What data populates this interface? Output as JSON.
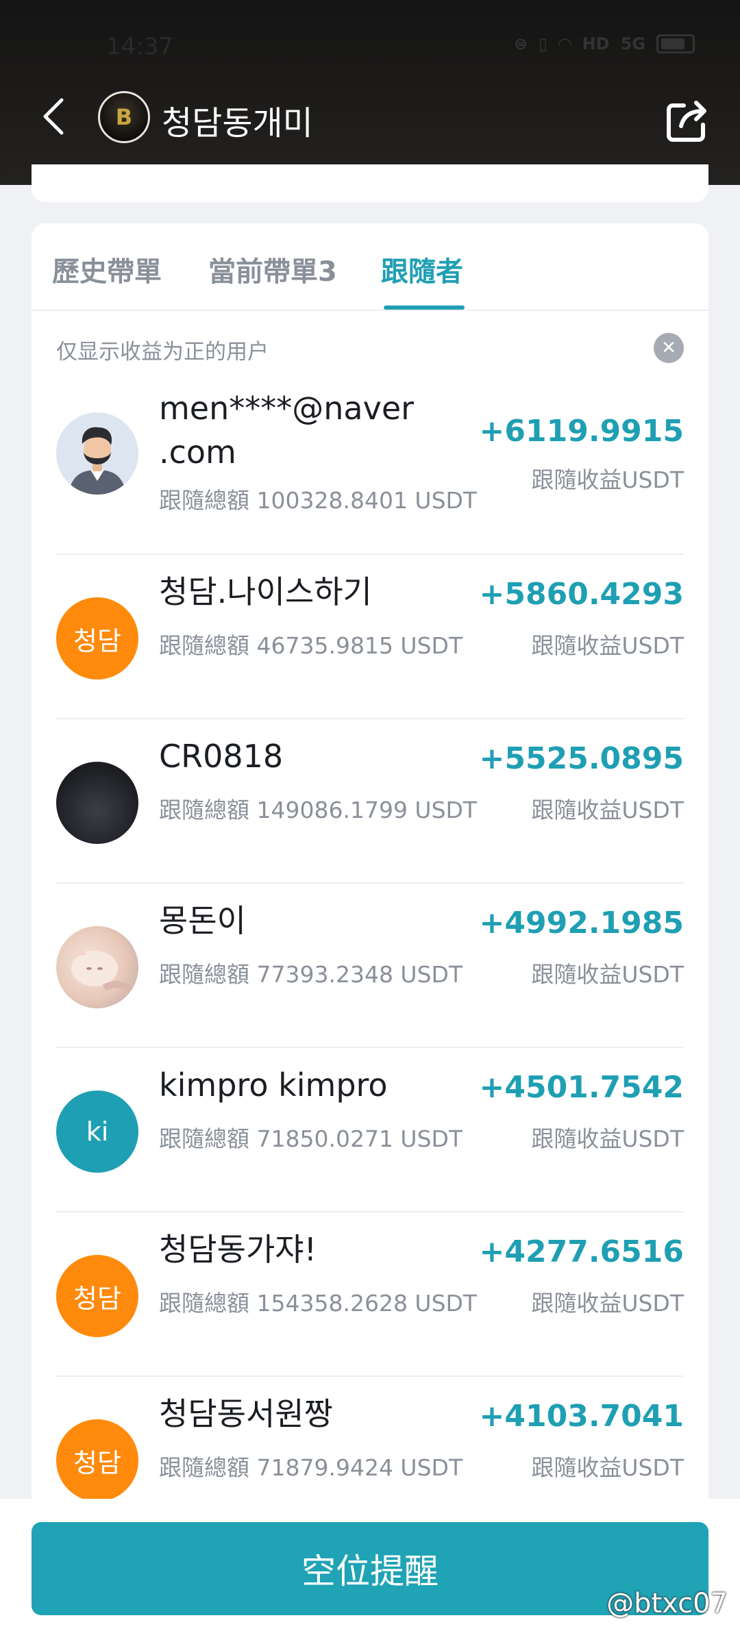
{
  "status": {
    "time": "14:37",
    "icons": [
      "vpn-icon",
      "vibrate-icon",
      "wifi-icon",
      "hd-icon",
      "signal-5g-icon",
      "battery-icon"
    ]
  },
  "header": {
    "title": "청담동개미",
    "avatar_text": "B"
  },
  "tabs": [
    {
      "label": "歷史帶單"
    },
    {
      "label": "當前帶單3"
    },
    {
      "label": "跟隨者"
    }
  ],
  "filter": {
    "text": "仅显示收益为正的用户"
  },
  "followers": [
    {
      "name_line1": "men****@naver",
      "name_line2": ".com",
      "total": "跟隨總額 100328.8401 USDT",
      "profit": "+6119.9915",
      "profit_label": "跟隨收益USDT",
      "avatar": "man-icon"
    },
    {
      "name_line1": "청담.나이스하기",
      "total": "跟隨總額 46735.9815 USDT",
      "profit": "+5860.4293",
      "profit_label": "跟隨收益USDT",
      "avatar_text": "청담"
    },
    {
      "name_line1": "CR0818",
      "total": "跟隨總額 149086.1799 USDT",
      "profit": "+5525.0895",
      "profit_label": "跟隨收益USDT",
      "avatar": "dark-photo"
    },
    {
      "name_line1": "몽돈이",
      "total": "跟隨總額 77393.2348 USDT",
      "profit": "+4992.1985",
      "profit_label": "跟隨收益USDT",
      "avatar": "cat-photo"
    },
    {
      "name_line1": "kimpro kimpro",
      "total": "跟隨總額 71850.0271 USDT",
      "profit": "+4501.7542",
      "profit_label": "跟隨收益USDT",
      "avatar_text": "ki"
    },
    {
      "name_line1": "청담동가쟈!",
      "total": "跟隨總額 154358.2628 USDT",
      "profit": "+4277.6516",
      "profit_label": "跟隨收益USDT",
      "avatar_text": "청담"
    },
    {
      "name_line1": "청담동서원짱",
      "total": "跟隨總額 71879.9424 USDT",
      "profit": "+4103.7041",
      "profit_label": "跟隨收益USDT",
      "avatar_text": "청담"
    }
  ],
  "bottom": {
    "button_label": "空位提醒"
  },
  "watermark": "@btxc07",
  "colors": {
    "accent": "#1f9fb3",
    "orange": "#ff8a0c",
    "header_bg": "#1a1917"
  }
}
